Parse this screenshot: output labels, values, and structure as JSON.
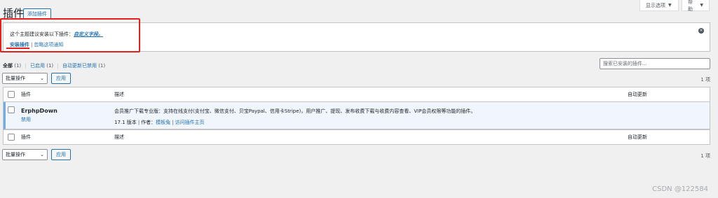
{
  "header": {
    "screen_options": "显示选项",
    "help": "帮助",
    "title": "插件",
    "add_new": "添加插件"
  },
  "notice": {
    "message": "这个主题建议安装以下插件：",
    "plugin_link": "自定义字段。",
    "install_link": "安装插件",
    "separator": "|",
    "dismiss_link": "忽略这项通知",
    "highlight_color": "#e3201b"
  },
  "filters": {
    "all_label": "全部",
    "all_count": "(1)",
    "active_label": "已启用",
    "active_count": "(1)",
    "autoupdate_label": "自动更新已禁用",
    "autoupdate_count": "(1)",
    "search_placeholder": "搜索已安装的插件..."
  },
  "bulk_top": {
    "select": "批量操作",
    "apply": "应用",
    "count": "1 项"
  },
  "bulk_bottom": {
    "select": "批量操作",
    "apply": "应用",
    "count": "1 项"
  },
  "table": {
    "col_plugin": "插件",
    "col_desc": "描述",
    "col_auto": "自动更新",
    "rows": [
      {
        "name": "ErphpDown",
        "action": "禁用",
        "description": "会员推广下载专业版：支持在线支付(支付宝、微信支付、贝宝Paypal、信用卡Stripe)，用户推广、提现、发布收费下载与收费内容查看、VIP会员权限等功能的插件。",
        "version": "17.1 版本",
        "author_label": "作者：",
        "author": "模板兔",
        "plugin_site": "访问插件主页"
      }
    ]
  },
  "watermark": "CSDN @122584",
  "colors": {
    "accent": "#2271b1",
    "active_row_border": "#72aee6",
    "active_row_bg": "#f0f6fc"
  }
}
